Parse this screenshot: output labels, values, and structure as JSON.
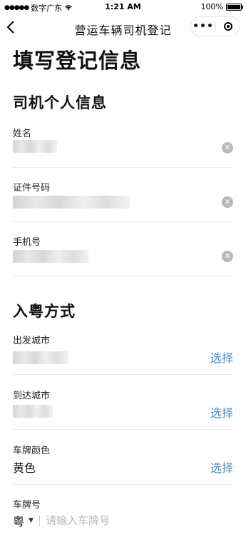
{
  "status_bar": {
    "carrier": "数字广东",
    "time": "1:21 AM",
    "battery": "100%"
  },
  "nav": {
    "title": "营运车辆司机登记",
    "more": "•••"
  },
  "page_title": "填写登记信息",
  "section_personal": {
    "title": "司机个人信息",
    "fields": [
      {
        "label": "姓名"
      },
      {
        "label": "证件号码"
      },
      {
        "label": "手机号"
      }
    ]
  },
  "section_entry": {
    "title": "入粤方式",
    "departure_label": "出发城市",
    "arrival_label": "到达城市",
    "plate_color_label": "车牌颜色",
    "plate_color_value": "黄色",
    "select_label": "选择",
    "plate_number_label": "车牌号",
    "plate_province": "粤",
    "plate_placeholder": "请输入车牌号"
  },
  "icons": {
    "clear": "clear-icon",
    "back": "back-arrow-icon",
    "wifi": "wifi-icon",
    "signal": "signal-dots-icon",
    "battery": "battery-icon",
    "close_target": "target-circle-icon"
  },
  "colors": {
    "link": "#4a90c9",
    "clear_icon": "#b9b9b9"
  }
}
